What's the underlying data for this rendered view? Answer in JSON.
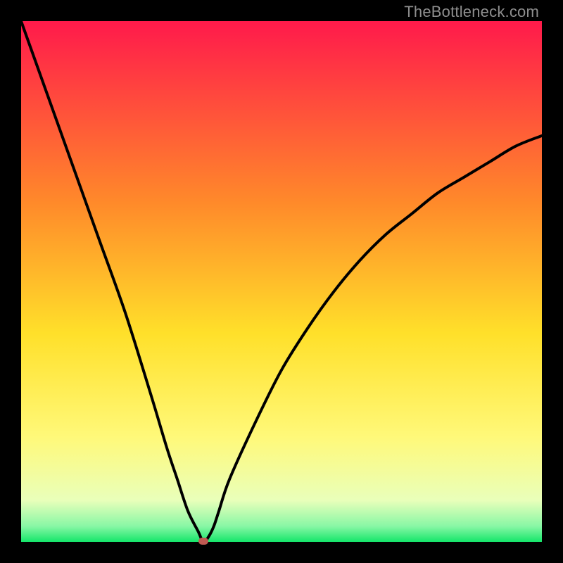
{
  "watermark": "TheBottleneck.com",
  "chart_data": {
    "type": "line",
    "title": "",
    "xlabel": "",
    "ylabel": "",
    "xlim": [
      0,
      100
    ],
    "ylim": [
      0,
      100
    ],
    "grid": false,
    "legend": false,
    "gradient_stops": [
      {
        "pct": 0,
        "color": "#ff1a4b"
      },
      {
        "pct": 35,
        "color": "#ff8a2a"
      },
      {
        "pct": 60,
        "color": "#ffe02a"
      },
      {
        "pct": 80,
        "color": "#fff97a"
      },
      {
        "pct": 92,
        "color": "#e9ffba"
      },
      {
        "pct": 97,
        "color": "#88f7a5"
      },
      {
        "pct": 100,
        "color": "#15e66a"
      }
    ],
    "series": [
      {
        "name": "bottleneck-curve",
        "x": [
          0,
          5,
          10,
          15,
          20,
          25,
          28,
          30,
          32,
          34,
          35,
          36,
          37,
          38,
          40,
          45,
          50,
          55,
          60,
          65,
          70,
          75,
          80,
          85,
          90,
          95,
          100
        ],
        "y": [
          100,
          86,
          72,
          58,
          44,
          28,
          18,
          12,
          6,
          2,
          0,
          1,
          3,
          6,
          12,
          23,
          33,
          41,
          48,
          54,
          59,
          63,
          67,
          70,
          73,
          76,
          78
        ]
      }
    ],
    "marker": {
      "x": 35,
      "y": 0,
      "color": "#c05a52"
    }
  }
}
